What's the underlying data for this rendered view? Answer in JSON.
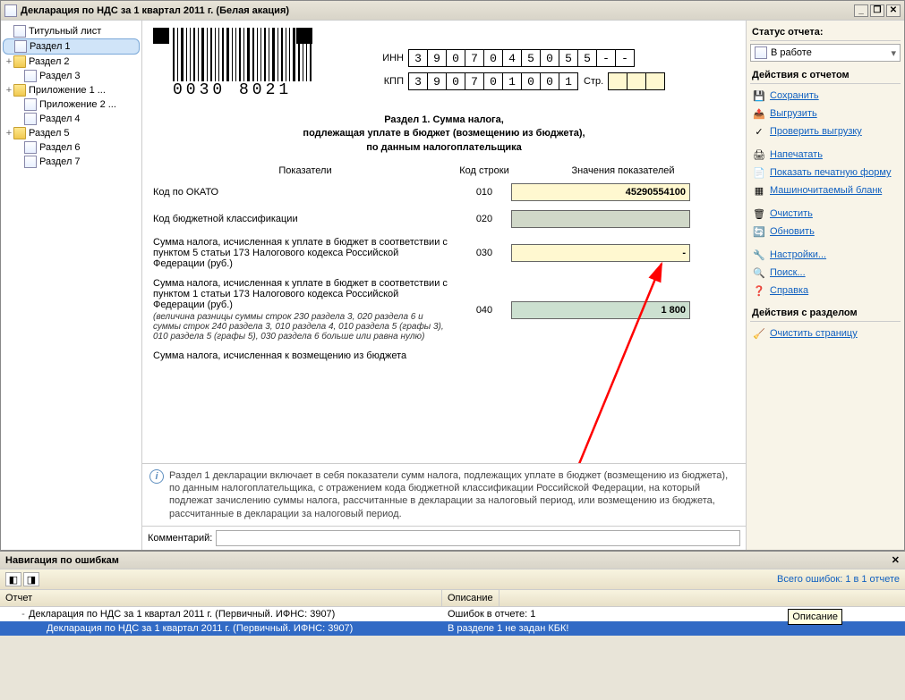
{
  "window": {
    "title": "Декларация по НДС за 1 квартал 2011 г. (Белая акация)"
  },
  "tree": {
    "items": [
      {
        "label": "Титульный лист",
        "icon": "doc",
        "level": 0,
        "exp": ""
      },
      {
        "label": "Раздел 1",
        "icon": "doc",
        "level": 0,
        "exp": "",
        "selected": true
      },
      {
        "label": "Раздел 2",
        "icon": "folder",
        "level": 0,
        "exp": "+"
      },
      {
        "label": "Раздел 3",
        "icon": "doc",
        "level": 1,
        "exp": ""
      },
      {
        "label": "Приложение 1 ...",
        "icon": "folder",
        "level": 0,
        "exp": "+"
      },
      {
        "label": "Приложение 2 ...",
        "icon": "doc",
        "level": 1,
        "exp": ""
      },
      {
        "label": "Раздел 4",
        "icon": "doc",
        "level": 1,
        "exp": ""
      },
      {
        "label": "Раздел 5",
        "icon": "folder",
        "level": 0,
        "exp": "+"
      },
      {
        "label": "Раздел 6",
        "icon": "doc",
        "level": 1,
        "exp": ""
      },
      {
        "label": "Раздел 7",
        "icon": "doc",
        "level": 1,
        "exp": ""
      }
    ]
  },
  "form": {
    "barcode_number": "0030 8021",
    "inn_label": "ИНН",
    "inn": [
      "3",
      "9",
      "0",
      "7",
      "0",
      "4",
      "5",
      "0",
      "5",
      "5",
      "-",
      "-"
    ],
    "kpp_label": "КПП",
    "kpp": [
      "3",
      "9",
      "0",
      "7",
      "0",
      "1",
      "0",
      "0",
      "1"
    ],
    "str_label": "Стр.",
    "section_title_l1": "Раздел 1. Сумма налога,",
    "section_title_l2": "подлежащая уплате в бюджет (возмещению из бюджета),",
    "section_title_l3": "по данным налогоплательщика",
    "header_col1": "Показатели",
    "header_col2": "Код строки",
    "header_col3": "Значения показателей",
    "rows": [
      {
        "label": "Код по ОКАТО",
        "code": "010",
        "value": "45290554100",
        "style": "yellow"
      },
      {
        "label": "Код бюджетной классификации",
        "code": "020",
        "value": "",
        "style": "gray"
      },
      {
        "label": "Сумма налога, исчисленная к уплате в бюджет в соответствии с пунктом 5 статьи 173 Налогового кодекса Российской Федерации (руб.)",
        "code": "030",
        "value": "-",
        "style": "yellow"
      },
      {
        "label": "Сумма налога, исчисленная к уплате в бюджет в соответствии с пунктом 1 статьи 173 Налогового кодекса Российской Федерации (руб.)",
        "note": "(величина разницы суммы строк 230 раздела 3, 020 раздела 6 и суммы строк 240 раздела 3, 010 раздела 4, 010 раздела 5 (графы 3), 010 раздела 5 (графы 5), 030 раздела 6 больше или равна нулю)",
        "code": "040",
        "value": "1 800",
        "style": "green"
      },
      {
        "label": "Сумма налога, исчисленная к возмещению из бюджета",
        "code": "",
        "value": "",
        "style": ""
      }
    ]
  },
  "info_text": "Раздел 1 декларации включает в себя показатели сумм налога, подлежащих уплате в бюджет (возмещению из бюджета), по данным налогоплательщика, с отражением кода бюджетной классификации Российской Федерации, на который подлежат зачислению суммы налога, рассчитанные в декларации за налоговый период, или возмещению из бюджета, рассчитанные в декларации за  налоговый период.",
  "comment_label": "Комментарий:",
  "status": {
    "group_title": "Статус отчета:",
    "value": "В работе"
  },
  "actions": {
    "group_title": "Действия с отчетом",
    "items": [
      {
        "label": "Сохранить",
        "icon": "save"
      },
      {
        "label": "Выгрузить",
        "icon": "export"
      },
      {
        "label": "Проверить выгрузку",
        "icon": "check"
      }
    ],
    "items2": [
      {
        "label": "Напечатать",
        "icon": "print"
      },
      {
        "label": "Показать печатную форму",
        "icon": "printform"
      },
      {
        "label": "Машиночитаемый бланк",
        "icon": "blank"
      }
    ],
    "items3": [
      {
        "label": "Очистить",
        "icon": "clear"
      },
      {
        "label": "Обновить",
        "icon": "refresh"
      }
    ],
    "items4": [
      {
        "label": "Настройки...",
        "icon": "settings"
      },
      {
        "label": "Поиск...",
        "icon": "search"
      },
      {
        "label": "Справка",
        "icon": "help"
      }
    ]
  },
  "section_actions": {
    "group_title": "Действия с разделом",
    "items": [
      {
        "label": "Очистить страницу",
        "icon": "clearpage"
      }
    ]
  },
  "errors": {
    "title": "Навигация по ошибкам",
    "summary": "Всего ошибок: 1 в 1 отчете",
    "col1": "Отчет",
    "col2": "Описание",
    "rows": [
      {
        "c1": "Декларация по НДС за 1 квартал 2011 г. (Первичный. ИФНС: 3907)",
        "c2": "Ошибок в отчете: 1",
        "exp": "-",
        "sel": false
      },
      {
        "c1": "Декларация по НДС за 1 квартал 2011 г. (Первичный. ИФНС: 3907)",
        "c2": "В разделе 1 не задан КБК!",
        "exp": "",
        "sel": true,
        "child": true
      }
    ],
    "tooltip": "Описание"
  }
}
